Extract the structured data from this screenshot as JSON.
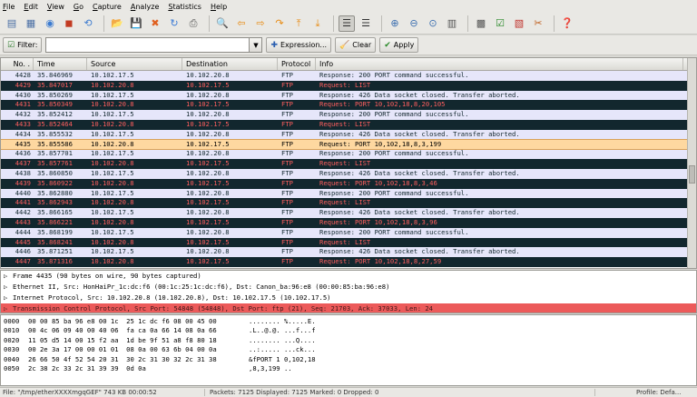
{
  "menu": [
    {
      "accel": "F",
      "rest": "ile"
    },
    {
      "accel": "E",
      "rest": "dit"
    },
    {
      "accel": "V",
      "rest": "iew"
    },
    {
      "accel": "G",
      "rest": "o"
    },
    {
      "accel": "C",
      "rest": "apture"
    },
    {
      "accel": "A",
      "rest": "nalyze"
    },
    {
      "accel": "S",
      "rest": "tatistics"
    },
    {
      "accel": "H",
      "rest": "elp"
    }
  ],
  "filter": {
    "label": "Filter:",
    "value": "",
    "expression_label": "Expression...",
    "clear_label": "Clear",
    "apply_label": "Apply"
  },
  "columns": {
    "no": "No. .",
    "time": "Time",
    "source": "Source",
    "destination": "Destination",
    "protocol": "Protocol",
    "info": "Info"
  },
  "packets": [
    {
      "no": "4428",
      "time": "35.846969",
      "src": "10.102.17.5",
      "dst": "10.102.20.8",
      "proto": "FTP",
      "info": "Response: 200 PORT command successful.",
      "type": "resp"
    },
    {
      "no": "4429",
      "time": "35.847017",
      "src": "10.102.20.8",
      "dst": "10.102.17.5",
      "proto": "FTP",
      "info": "Request: LIST",
      "type": "req"
    },
    {
      "no": "4430",
      "time": "35.850269",
      "src": "10.102.17.5",
      "dst": "10.102.20.8",
      "proto": "FTP",
      "info": "Response: 426 Data socket closed. Transfer aborted.",
      "type": "resp"
    },
    {
      "no": "4431",
      "time": "35.850349",
      "src": "10.102.20.8",
      "dst": "10.102.17.5",
      "proto": "FTP",
      "info": "Request: PORT 10,102,18,8,20,105",
      "type": "req"
    },
    {
      "no": "4432",
      "time": "35.852412",
      "src": "10.102.17.5",
      "dst": "10.102.20.8",
      "proto": "FTP",
      "info": "Response: 200 PORT command successful.",
      "type": "resp"
    },
    {
      "no": "4433",
      "time": "35.852464",
      "src": "10.102.20.8",
      "dst": "10.102.17.5",
      "proto": "FTP",
      "info": "Request: LIST",
      "type": "req"
    },
    {
      "no": "4434",
      "time": "35.855532",
      "src": "10.102.17.5",
      "dst": "10.102.20.8",
      "proto": "FTP",
      "info": "Response: 426 Data socket closed. Transfer aborted.",
      "type": "resp"
    },
    {
      "no": "4435",
      "time": "35.855586",
      "src": "10.102.20.8",
      "dst": "10.102.17.5",
      "proto": "FTP",
      "info": "Request: PORT 10,102,18,8,3,199",
      "type": "sel"
    },
    {
      "no": "4436",
      "time": "35.857701",
      "src": "10.102.17.5",
      "dst": "10.102.20.8",
      "proto": "FTP",
      "info": "Response: 200 PORT command successful.",
      "type": "resp"
    },
    {
      "no": "4437",
      "time": "35.857761",
      "src": "10.102.20.8",
      "dst": "10.102.17.5",
      "proto": "FTP",
      "info": "Request: LIST",
      "type": "req"
    },
    {
      "no": "4438",
      "time": "35.860850",
      "src": "10.102.17.5",
      "dst": "10.102.20.8",
      "proto": "FTP",
      "info": "Response: 426 Data socket closed. Transfer aborted.",
      "type": "resp"
    },
    {
      "no": "4439",
      "time": "35.860922",
      "src": "10.102.20.8",
      "dst": "10.102.17.5",
      "proto": "FTP",
      "info": "Request: PORT 10,102,18,8,3,46",
      "type": "req"
    },
    {
      "no": "4440",
      "time": "35.862880",
      "src": "10.102.17.5",
      "dst": "10.102.20.8",
      "proto": "FTP",
      "info": "Response: 200 PORT command successful.",
      "type": "resp"
    },
    {
      "no": "4441",
      "time": "35.862943",
      "src": "10.102.20.8",
      "dst": "10.102.17.5",
      "proto": "FTP",
      "info": "Request: LIST",
      "type": "req"
    },
    {
      "no": "4442",
      "time": "35.866165",
      "src": "10.102.17.5",
      "dst": "10.102.20.8",
      "proto": "FTP",
      "info": "Response: 426 Data socket closed. Transfer aborted.",
      "type": "resp"
    },
    {
      "no": "4443",
      "time": "35.866221",
      "src": "10.102.20.8",
      "dst": "10.102.17.5",
      "proto": "FTP",
      "info": "Request: PORT 10,102,18,8,3,96",
      "type": "req"
    },
    {
      "no": "4444",
      "time": "35.868199",
      "src": "10.102.17.5",
      "dst": "10.102.20.8",
      "proto": "FTP",
      "info": "Response: 200 PORT command successful.",
      "type": "resp"
    },
    {
      "no": "4445",
      "time": "35.868241",
      "src": "10.102.20.8",
      "dst": "10.102.17.5",
      "proto": "FTP",
      "info": "Request: LIST",
      "type": "req"
    },
    {
      "no": "4446",
      "time": "35.871251",
      "src": "10.102.17.5",
      "dst": "10.102.20.8",
      "proto": "FTP",
      "info": "Response: 426 Data socket closed. Transfer aborted.",
      "type": "resp"
    },
    {
      "no": "4447",
      "time": "35.871316",
      "src": "10.102.20.8",
      "dst": "10.102.17.5",
      "proto": "FTP",
      "info": "Request: PORT 10,102,18,8,27,59",
      "type": "req"
    }
  ],
  "details": [
    {
      "text": "Frame 4435 (90 bytes on wire, 90 bytes captured)",
      "highlight": false
    },
    {
      "text": "Ethernet II, Src: HonHaiPr_1c:dc:f6 (00:1c:25:1c:dc:f6), Dst: Canon_ba:96:e8 (00:00:85:ba:96:e8)",
      "highlight": false
    },
    {
      "text": "Internet Protocol, Src: 10.102.20.8 (10.102.20.8), Dst: 10.102.17.5 (10.102.17.5)",
      "highlight": false
    },
    {
      "text": "Transmission Control Protocol, Src Port: 54848 (54848), Dst Port: ftp (21), Seq: 21703, Ack: 37033, Len: 24",
      "highlight": true
    }
  ],
  "hex": [
    {
      "off": "0000",
      "hex": "00 00 85 ba 96 e8 00 1c  25 1c dc f6 08 00 45 00",
      "ascii": "........ %.....E."
    },
    {
      "off": "0010",
      "hex": "00 4c 06 09 40 00 40 06  fa ca 0a 66 14 08 0a 66",
      "ascii": ".L..@.@. ...f...f"
    },
    {
      "off": "0020",
      "hex": "11 05 d5 14 00 15 f2 aa  1d be 9f 51 a8 f8 80 18",
      "ascii": "........ ...Q...."
    },
    {
      "off": "0030",
      "hex": "00 2e 3a 17 00 00 01 01  08 0a 00 63 6b 04 00 0a",
      "ascii": "..:..... ...ck..."
    },
    {
      "off": "0040",
      "hex": "26 66 50 4f 52 54 20 31  30 2c 31 30 32 2c 31 38",
      "ascii": "&fPORT 1 0,102,18"
    },
    {
      "off": "0050",
      "hex": "2c 38 2c 33 2c 31 39 39  0d 0a",
      "ascii": ",8,3,199 .."
    }
  ],
  "status": {
    "file": "File: \"/tmp/etherXXXXmgqGEF\" 743 KB 00:00:52",
    "packets": "Packets: 7125 Displayed: 7125 Marked: 0 Dropped: 0",
    "profile": "Profile: Defa..."
  }
}
